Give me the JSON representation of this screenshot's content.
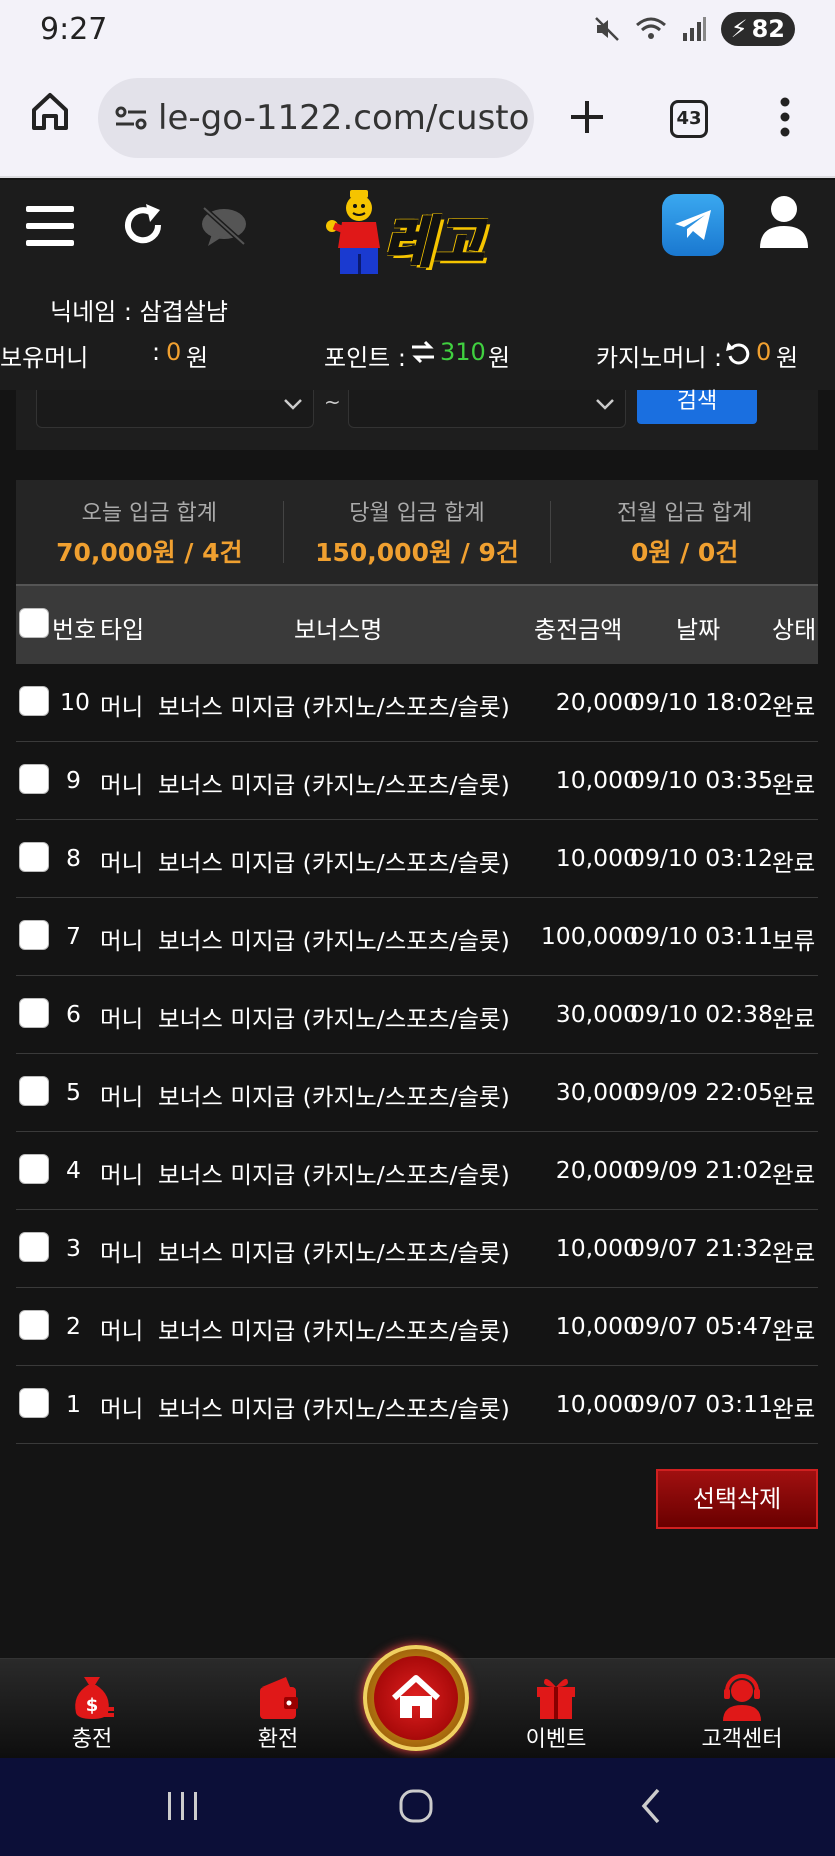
{
  "status_bar": {
    "time": "9:27",
    "battery": "82"
  },
  "browser": {
    "url": "le-go-1122.com/custo",
    "tab_count": "43"
  },
  "header": {
    "logo_text": "레고",
    "nickname_label": "닉네임 : 삼겹살냠",
    "balance_label": "보유머니",
    "balance_colon": ":",
    "balance_value": "0",
    "balance_unit": "원",
    "points_label": "포인트 :",
    "points_value": "310",
    "points_unit": "원",
    "casino_label": "카지노머니 :",
    "casino_value": "0",
    "casino_unit": "원"
  },
  "filter": {
    "tilde": "~",
    "search_label": "검색"
  },
  "summary": [
    {
      "label": "오늘 입금 합계",
      "value": "70,000원 / 4건"
    },
    {
      "label": "당월 입금 합계",
      "value": "150,000원 / 9건"
    },
    {
      "label": "전월 입금 합계",
      "value": "0원 / 0건"
    }
  ],
  "table": {
    "headers": {
      "number": "번호",
      "type": "타입",
      "bonus": "보너스명",
      "amount": "충전금액",
      "date": "날짜",
      "status": "상태"
    },
    "rows": [
      {
        "no": "10",
        "type": "머니",
        "bonus": "보너스 미지급 (카지노/스포츠/슬롯)",
        "amount": "20,000",
        "date": "09/10 18:02",
        "status": "완료"
      },
      {
        "no": "9",
        "type": "머니",
        "bonus": "보너스 미지급 (카지노/스포츠/슬롯)",
        "amount": "10,000",
        "date": "09/10 03:35",
        "status": "완료"
      },
      {
        "no": "8",
        "type": "머니",
        "bonus": "보너스 미지급 (카지노/스포츠/슬롯)",
        "amount": "10,000",
        "date": "09/10 03:12",
        "status": "완료"
      },
      {
        "no": "7",
        "type": "머니",
        "bonus": "보너스 미지급 (카지노/스포츠/슬롯)",
        "amount": "100,000",
        "date": "09/10 03:11",
        "status": "보류"
      },
      {
        "no": "6",
        "type": "머니",
        "bonus": "보너스 미지급 (카지노/스포츠/슬롯)",
        "amount": "30,000",
        "date": "09/10 02:38",
        "status": "완료"
      },
      {
        "no": "5",
        "type": "머니",
        "bonus": "보너스 미지급 (카지노/스포츠/슬롯)",
        "amount": "30,000",
        "date": "09/09 22:05",
        "status": "완료"
      },
      {
        "no": "4",
        "type": "머니",
        "bonus": "보너스 미지급 (카지노/스포츠/슬롯)",
        "amount": "20,000",
        "date": "09/09 21:02",
        "status": "완료"
      },
      {
        "no": "3",
        "type": "머니",
        "bonus": "보너스 미지급 (카지노/스포츠/슬롯)",
        "amount": "10,000",
        "date": "09/07 21:32",
        "status": "완료"
      },
      {
        "no": "2",
        "type": "머니",
        "bonus": "보너스 미지급 (카지노/스포츠/슬롯)",
        "amount": "10,000",
        "date": "09/07 05:47",
        "status": "완료"
      },
      {
        "no": "1",
        "type": "머니",
        "bonus": "보너스 미지급 (카지노/스포츠/슬롯)",
        "amount": "10,000",
        "date": "09/07 03:11",
        "status": "완료"
      }
    ]
  },
  "delete_button": "선택삭제",
  "bottom_nav": {
    "charge": "충전",
    "exchange": "환전",
    "event": "이벤트",
    "support": "고객센터"
  }
}
